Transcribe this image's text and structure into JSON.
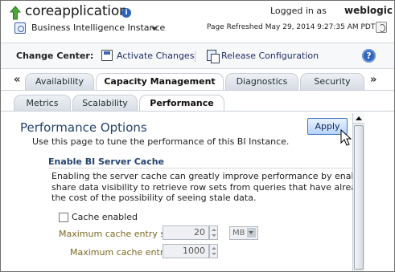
{
  "header": {
    "app_title": "coreapplication",
    "logged_in_label": "Logged in as",
    "username": "weblogic",
    "instance_menu": "Business Intelligence Instance",
    "refreshed": "Page Refreshed May 29, 2014 9:27:35 AM PDT",
    "icons": {
      "up": "up-arrow-icon",
      "info": "info-icon",
      "instance": "bi-instance-icon",
      "refresh": "refresh-icon"
    }
  },
  "change_center": {
    "label": "Change Center:",
    "activate": "Activate Changes",
    "release": "Release Configuration",
    "help": "?"
  },
  "main_tabs": {
    "prev": "«",
    "next": "»",
    "items": [
      {
        "label": "Availability",
        "selected": false
      },
      {
        "label": "Capacity Management",
        "selected": true
      },
      {
        "label": "Diagnostics",
        "selected": false
      },
      {
        "label": "Security",
        "selected": false
      }
    ]
  },
  "sub_tabs": {
    "items": [
      {
        "label": "Metrics",
        "selected": false
      },
      {
        "label": "Scalability",
        "selected": false
      },
      {
        "label": "Performance",
        "selected": true
      }
    ]
  },
  "content": {
    "title": "Performance Options",
    "description": "Use this page to tune the performance of this BI Instance.",
    "apply": "Apply",
    "section_title": "Enable BI Server Cache",
    "paragraph_lines": [
      "Enabling the server cache can greatly improve performance by enabling users",
      "share data visibility to retrieve row sets from queries that have already been r",
      "the cost of the possibility of seeing stale data."
    ],
    "cache_enabled_label": "Cache enabled",
    "cache_enabled": false,
    "max_entry_size_label": "Maximum cache entry size",
    "max_entry_size_value": "20",
    "max_entry_size_unit": "MB",
    "max_entries_label": "Maximum cache entries",
    "max_entries_value": "1000"
  },
  "colors": {
    "accent": "#2f64bd",
    "title": "#24436e",
    "field_label": "#7a6820"
  }
}
